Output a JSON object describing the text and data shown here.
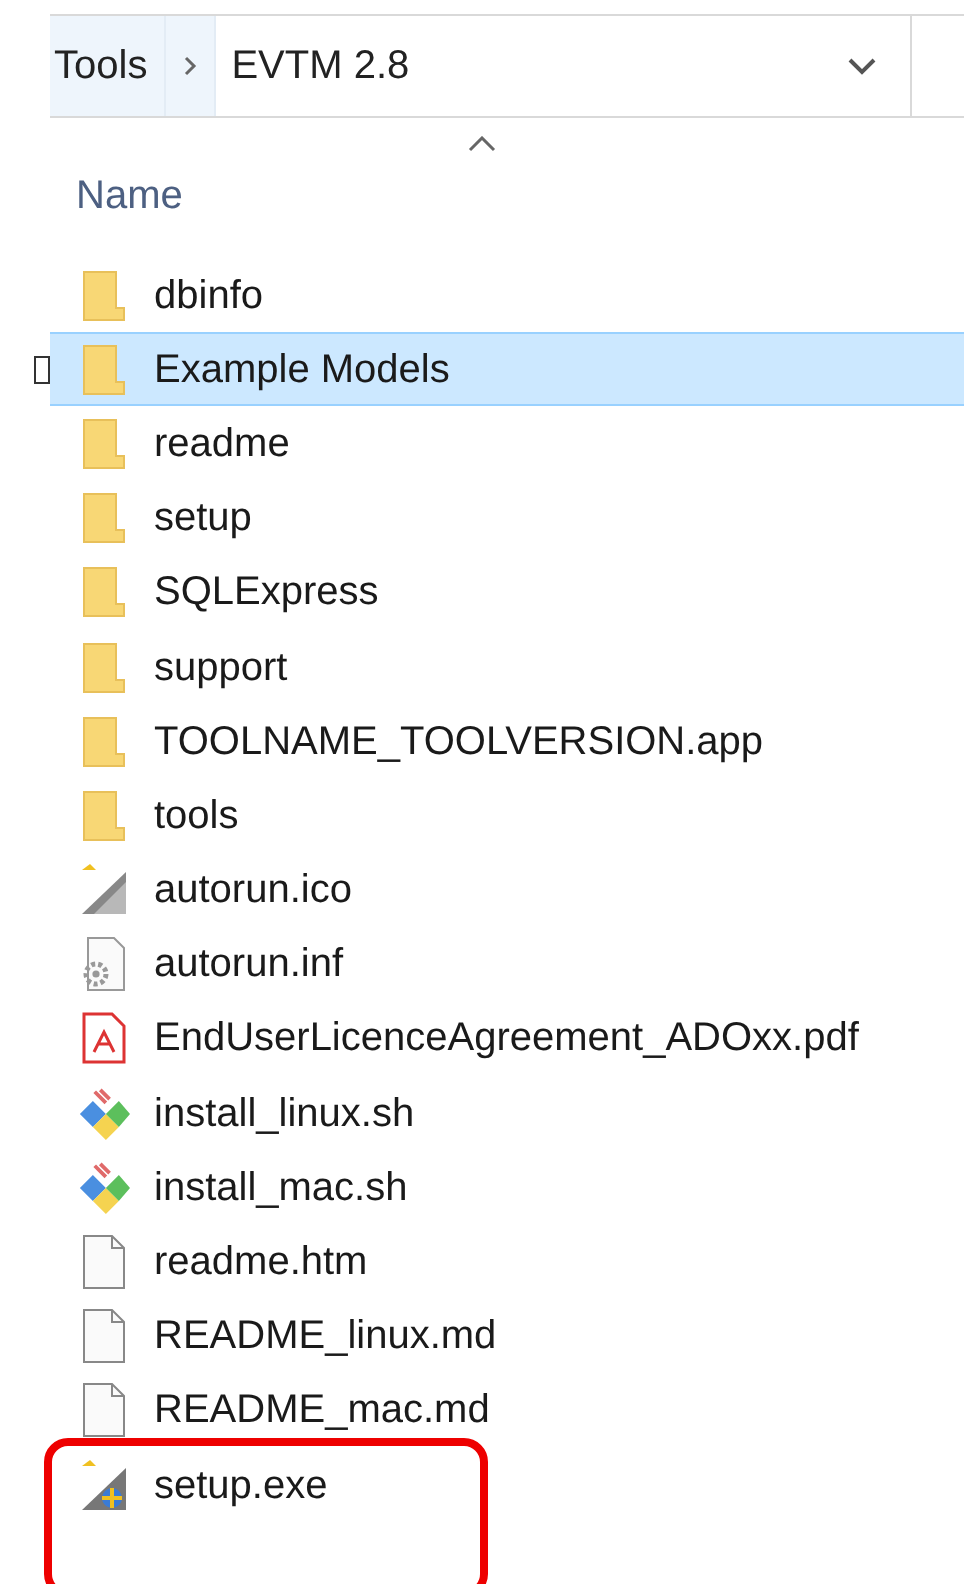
{
  "address_bar": {
    "segments": [
      "Tools",
      "EVTM 2.8"
    ]
  },
  "column_header": {
    "label": "Name"
  },
  "files": [
    {
      "name": "dbinfo",
      "kind": "folder",
      "selected": false,
      "highlighted": false
    },
    {
      "name": "Example Models",
      "kind": "folder",
      "selected": true,
      "highlighted": false
    },
    {
      "name": "readme",
      "kind": "folder",
      "selected": false,
      "highlighted": false
    },
    {
      "name": "setup",
      "kind": "folder",
      "selected": false,
      "highlighted": false
    },
    {
      "name": "SQLExpress",
      "kind": "folder",
      "selected": false,
      "highlighted": false
    },
    {
      "name": "support",
      "kind": "folder",
      "selected": false,
      "highlighted": false
    },
    {
      "name": "TOOLNAME_TOOLVERSION.app",
      "kind": "folder",
      "selected": false,
      "highlighted": false
    },
    {
      "name": "tools",
      "kind": "folder",
      "selected": false,
      "highlighted": false
    },
    {
      "name": "autorun.ico",
      "kind": "image",
      "selected": false,
      "highlighted": false
    },
    {
      "name": "autorun.inf",
      "kind": "settings",
      "selected": false,
      "highlighted": false
    },
    {
      "name": "EndUserLicenceAgreement_ADOxx.pdf",
      "kind": "pdf",
      "selected": false,
      "highlighted": false
    },
    {
      "name": "install_linux.sh",
      "kind": "script",
      "selected": false,
      "highlighted": false
    },
    {
      "name": "install_mac.sh",
      "kind": "script",
      "selected": false,
      "highlighted": false
    },
    {
      "name": "readme.htm",
      "kind": "document",
      "selected": false,
      "highlighted": false
    },
    {
      "name": "README_linux.md",
      "kind": "document",
      "selected": false,
      "highlighted": false
    },
    {
      "name": "README_mac.md",
      "kind": "document",
      "selected": false,
      "highlighted": false
    },
    {
      "name": "setup.exe",
      "kind": "exe",
      "selected": false,
      "highlighted": true
    }
  ]
}
